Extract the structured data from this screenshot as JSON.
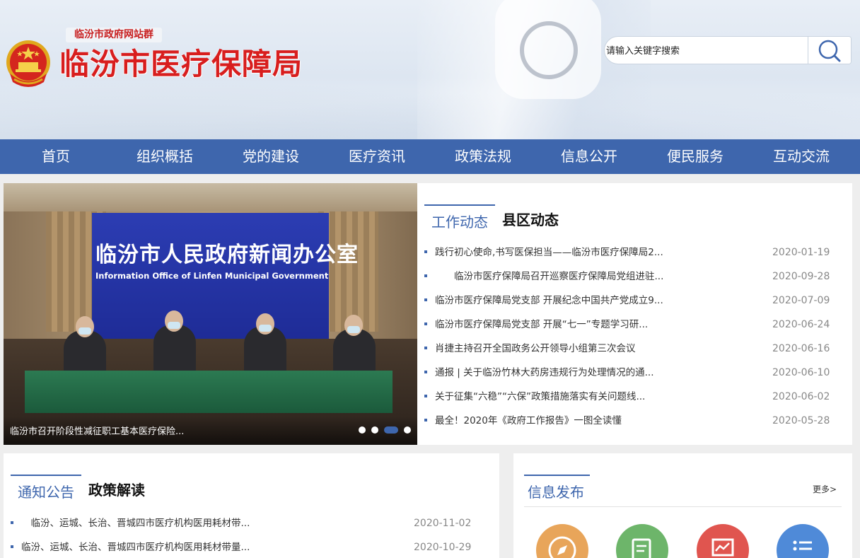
{
  "header": {
    "site_tag": "临汾市政府网站群",
    "site_title": "临汾市医疗保障局"
  },
  "search": {
    "placeholder": "请输入关键字搜索"
  },
  "nav": {
    "items": [
      "首页",
      "组织概括",
      "党的建设",
      "医疗资讯",
      "政策法规",
      "信息公开",
      "便民服务",
      "互动交流"
    ]
  },
  "slider": {
    "board_cn": "临汾市人民政府新闻办公室",
    "board_en": "Information Office of Linfen Municipal Government",
    "caption": "临汾市召开阶段性减征职工基本医疗保险...",
    "active_index": 2
  },
  "news": {
    "tabs": [
      "工作动态",
      "县区动态"
    ],
    "items": [
      {
        "title": "践行初心使命,书写医保担当——临汾市医疗保障局2...",
        "date": "2020-01-19"
      },
      {
        "title": "　　临汾市医疗保障局召开巡察医疗保障局党组进驻...",
        "date": "2020-09-28"
      },
      {
        "title": "临汾市医疗保障局党支部 开展纪念中国共产党成立9...",
        "date": "2020-07-09"
      },
      {
        "title": "临汾市医疗保障局党支部 开展“七一”专题学习研...",
        "date": "2020-06-24"
      },
      {
        "title": "肖捷主持召开全国政务公开领导小组第三次会议",
        "date": "2020-06-16"
      },
      {
        "title": "通报 | 关于临汾竹林大药房违规行为处理情况的通...",
        "date": "2020-06-10"
      },
      {
        "title": "关于征集“六稳”“六保”政策措施落实有关问题线...",
        "date": "2020-06-02"
      },
      {
        "title": "最全！2020年《政府工作报告》一图全读懂",
        "date": "2020-05-28"
      }
    ]
  },
  "notice": {
    "tabs": [
      "通知公告",
      "政策解读"
    ],
    "items": [
      {
        "title": "　临汾、运城、长治、晋城四市医疗机构医用耗材带...",
        "date": "2020-11-02"
      },
      {
        "title": "临汾、运城、长治、晋城四市医疗机构医用耗材带量...",
        "date": "2020-10-29"
      }
    ]
  },
  "info": {
    "title": "信息发布",
    "more": "更多>",
    "icons": [
      {
        "name": "compass-icon",
        "color": "#e8a55a"
      },
      {
        "name": "form-icon",
        "color": "#6db56a"
      },
      {
        "name": "chart-icon",
        "color": "#e0554f"
      },
      {
        "name": "list-icon",
        "color": "#4f8ad8"
      }
    ]
  },
  "colors": {
    "accent": "#3e66ad",
    "title_red": "#d81e1e"
  }
}
